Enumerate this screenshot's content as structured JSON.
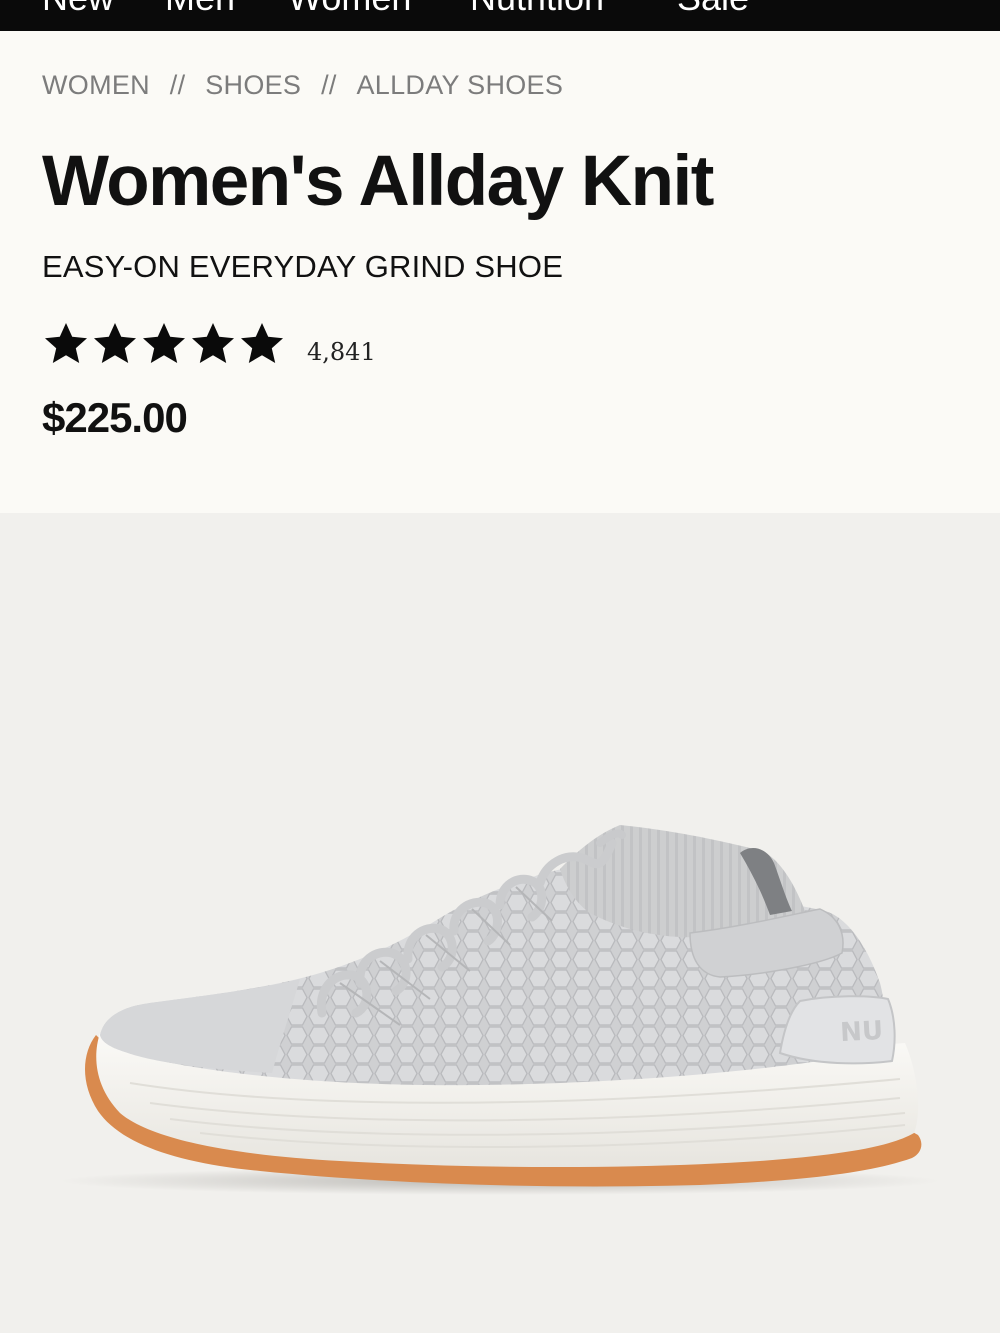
{
  "nav": {
    "items": [
      {
        "label": "New"
      },
      {
        "label": "Men"
      },
      {
        "label": "Women"
      },
      {
        "label": "Nutrition"
      },
      {
        "label": "Sale"
      }
    ]
  },
  "breadcrumb": {
    "separator": "//",
    "items": [
      {
        "label": "WOMEN"
      },
      {
        "label": "SHOES"
      },
      {
        "label": "ALLDAY SHOES"
      }
    ]
  },
  "product": {
    "title": "Women's Allday Knit",
    "subtitle": "EASY-ON EVERYDAY GRIND SHOE",
    "rating": {
      "stars": 5,
      "icon": "star-icon",
      "count": "4,841"
    },
    "price": "$225.00",
    "image": {
      "icon": "sneaker-image",
      "heel_tab_text": "NU",
      "colors": {
        "upper": "#d3d4d6",
        "sole": "#f6f5f1",
        "outsole": "#d98a4e",
        "background": "#f1f0ed"
      }
    }
  }
}
